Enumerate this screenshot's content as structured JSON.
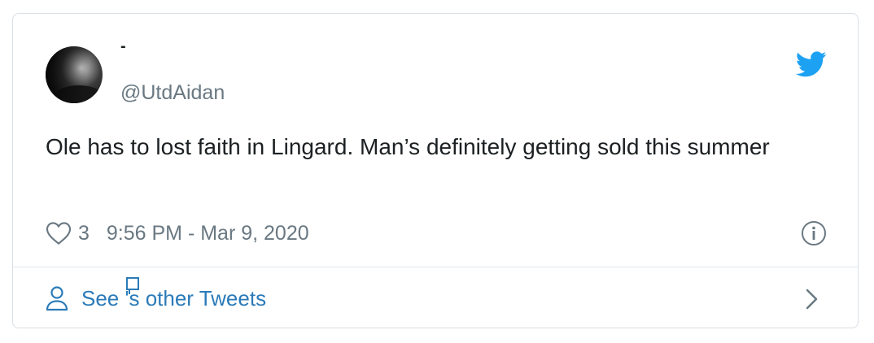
{
  "tweet": {
    "display_name": "-",
    "handle": "@UtdAidan",
    "text": "Ole has to lost faith in Lingard. Man’s definitely getting sold this summer",
    "like_count": "3",
    "timestamp": "9:56 PM - Mar 9, 2020"
  },
  "footer": {
    "label_before": "See ",
    "label_after": "'s other Tweets"
  },
  "icons": {
    "brand": "twitter-bird-icon",
    "like": "heart-icon",
    "info": "info-icon",
    "profile": "person-icon",
    "more": "chevron-right-icon",
    "missing_glyph": "missing-glyph-box"
  },
  "colors": {
    "twitter_blue": "#1da1f2",
    "link_blue": "#2b7bb9",
    "text": "#1c2022",
    "muted": "#697882",
    "border": "#d9dfe4"
  }
}
